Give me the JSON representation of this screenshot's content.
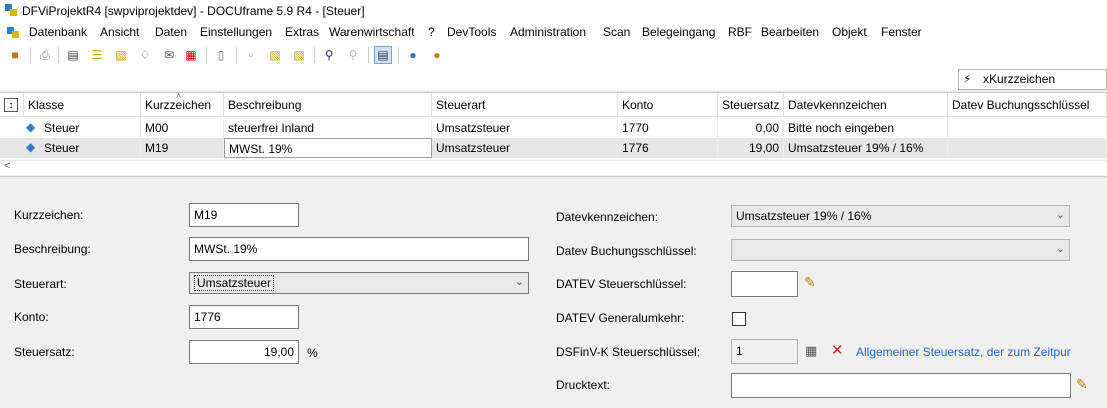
{
  "window": {
    "title": "DFViProjektR4 [swpviprojektdev] - DOCUframe 5.9 R4 - [Steuer]"
  },
  "menu": [
    "Datenbank",
    "Ansicht",
    "Daten",
    "Einstellungen",
    "Extras",
    "Warenwirtschaft",
    "?",
    "DevTools",
    "Administration",
    "Scan",
    "Belegeingang",
    "RBF",
    "Bearbeiten",
    "Objekt",
    "Fenster"
  ],
  "search": {
    "label": "xKurzzeichen"
  },
  "grid": {
    "columns": [
      "Klasse",
      "Kurzzeichen",
      "Beschreibung",
      "Steuerart",
      "Konto",
      "Steuersatz",
      "Datevkennzeichen",
      "Datev Buchungsschlüssel"
    ],
    "rows": [
      {
        "klasse": "Steuer",
        "kurz": "M00",
        "beschr": "steuerfrei Inland",
        "art": "Umsatzsteuer",
        "konto": "1770",
        "satz": "0,00",
        "datev": "Bitte noch eingeben",
        "buch": ""
      },
      {
        "klasse": "Steuer",
        "kurz": "M19",
        "beschr": "MWSt. 19%",
        "art": "Umsatzsteuer",
        "konto": "1776",
        "satz": "19,00",
        "datev": "Umsatzsteuer 19% / 16%",
        "buch": ""
      }
    ],
    "scroll_left": "<"
  },
  "form": {
    "kurz_label": "Kurzzeichen:",
    "kurz_value": "M19",
    "beschr_label": "Beschreibung:",
    "beschr_value": "MWSt. 19%",
    "art_label": "Steuerart:",
    "art_value": "Umsatzsteuer",
    "konto_label": "Konto:",
    "konto_value": "1776",
    "satz_label": "Steuersatz:",
    "satz_value": "19,00",
    "satz_unit": "%",
    "datev_label": "Datevkennzeichen:",
    "datev_value": "Umsatzsteuer 19% / 16%",
    "buch_label": "Datev Buchungsschlüssel:",
    "buch_value": "",
    "datevst_label": "DATEV Steuerschlüssel:",
    "datevst_value": "",
    "general_label": "DATEV Generalumkehr:",
    "dsfinv_label": "DSFinV-K Steuerschlüssel:",
    "dsfinv_value": "1",
    "dsfinv_link": "Allgemeiner Steuersatz, der zum Zeitpur",
    "druck_label": "Drucktext:",
    "druck_value": ""
  },
  "icons": {
    "toolbar": [
      "new-record-icon",
      "print-icon",
      "card-icon",
      "list-icon",
      "folder-icon",
      "tag-icon",
      "mail-icon",
      "calendar-icon",
      "phone-icon",
      "document-icon",
      "folder-open-icon",
      "folder-export-icon",
      "search-icon",
      "search-disabled-icon",
      "form-view-icon",
      "users-icon",
      "user-settings-icon"
    ]
  },
  "colors": {
    "link": "#1e64c8",
    "selected_row": "#e6e6e6"
  }
}
